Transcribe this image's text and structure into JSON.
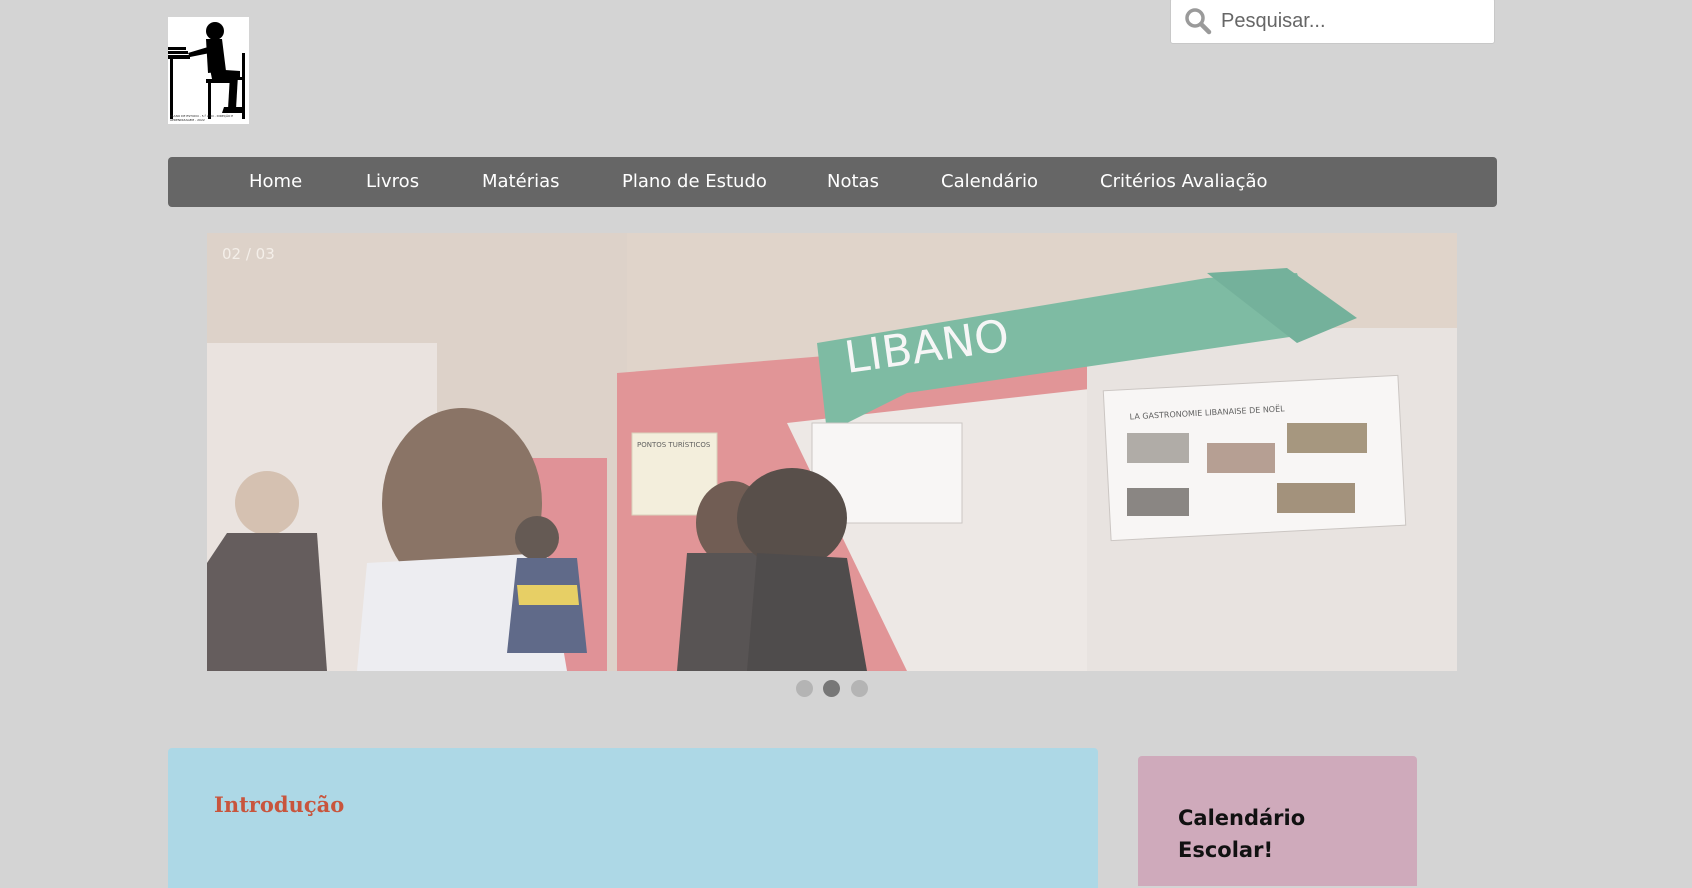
{
  "logo": {
    "icon": "person-at-desk-icon",
    "caption": "PLANO DE ESTUDO - 5.º ANO - DIREÇÃO E APRENDIZAGEM - 2022"
  },
  "search": {
    "placeholder": "Pesquisar...",
    "value": "",
    "icon": "search-icon"
  },
  "nav": {
    "items": [
      {
        "label": "Home"
      },
      {
        "label": "Livros"
      },
      {
        "label": "Matérias"
      },
      {
        "label": "Plano de Estudo"
      },
      {
        "label": "Notas"
      },
      {
        "label": "Calendário"
      },
      {
        "label": "Critérios Avaliação"
      }
    ]
  },
  "slider": {
    "counter": "02 / 03",
    "current": 2,
    "total": 3,
    "image": {
      "banner_text": "LIBANO",
      "poster_left": "PONTOS TURÍSTICOS",
      "poster_right": "LA GASTRONOMIE LIBANAISE DE NOËL"
    }
  },
  "intro": {
    "title": "Introdução"
  },
  "sidebar": {
    "calendar_title": "Calendário Escolar!"
  },
  "colors": {
    "background": "#d4d4d4",
    "nav_bg": "#666666",
    "intro_bg": "#add8e6",
    "intro_title": "#c8553d",
    "calendar_bg": "#cfaabb"
  }
}
